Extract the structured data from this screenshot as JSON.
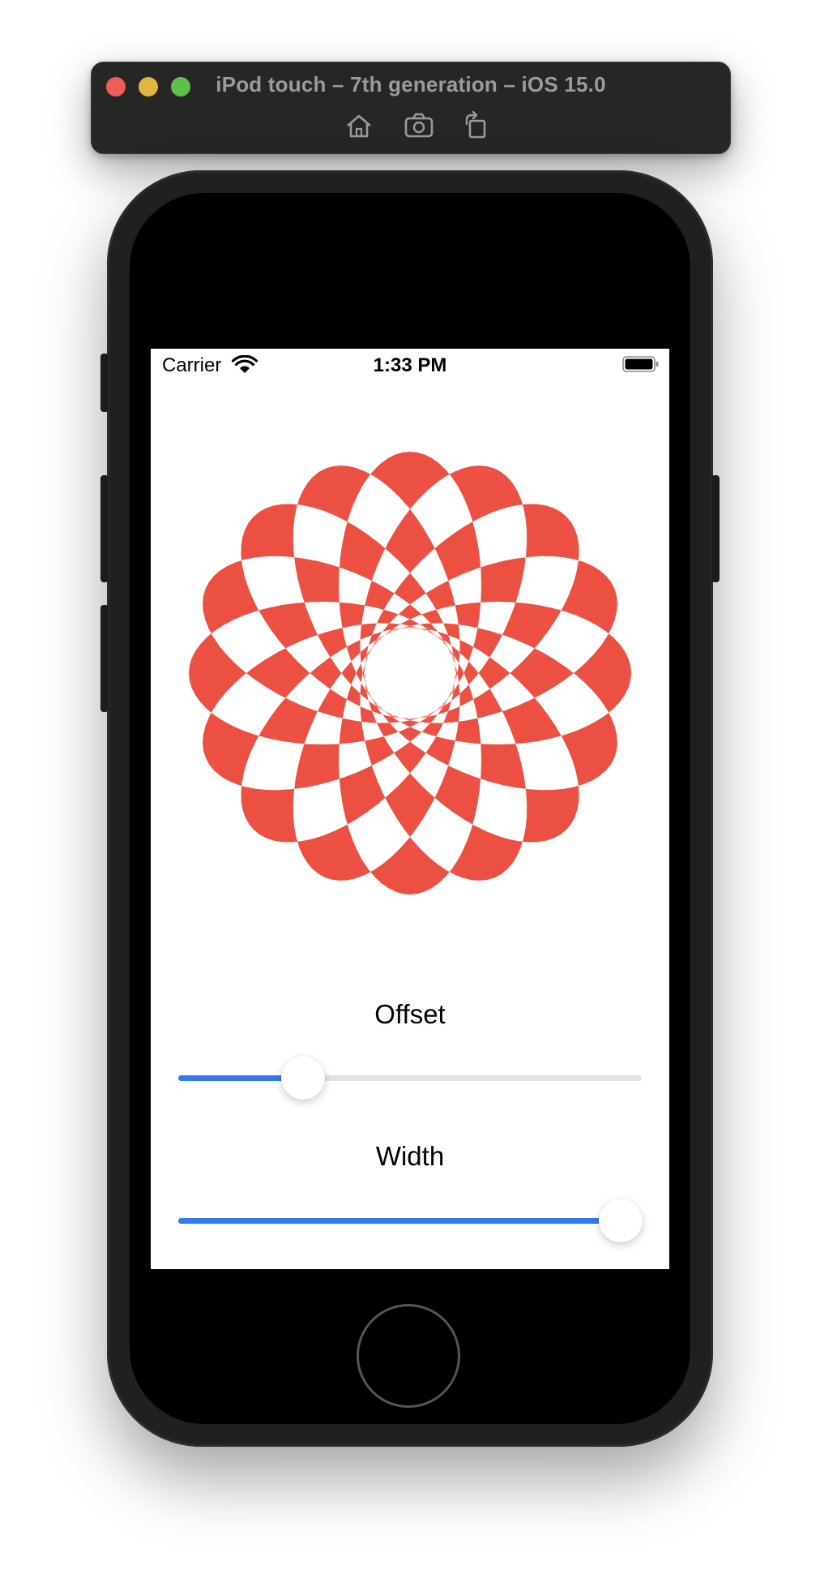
{
  "simulator": {
    "title": "iPod touch – 7th generation – iOS 15.0",
    "buttons": [
      "home-icon",
      "screenshot-icon",
      "rotate-icon"
    ]
  },
  "status_bar": {
    "carrier": "Carrier",
    "time": "1:33 PM",
    "wifi_icon": "wifi-icon",
    "battery_icon": "battery-icon"
  },
  "rosette": {
    "color": "#ec5042",
    "background": "#ffffff"
  },
  "controls": {
    "offset": {
      "label": "Offset",
      "value": 0.27
    },
    "width": {
      "label": "Width",
      "value": 0.955
    }
  },
  "colors": {
    "accent": "#3478f6",
    "track": "#e3e3e6"
  }
}
